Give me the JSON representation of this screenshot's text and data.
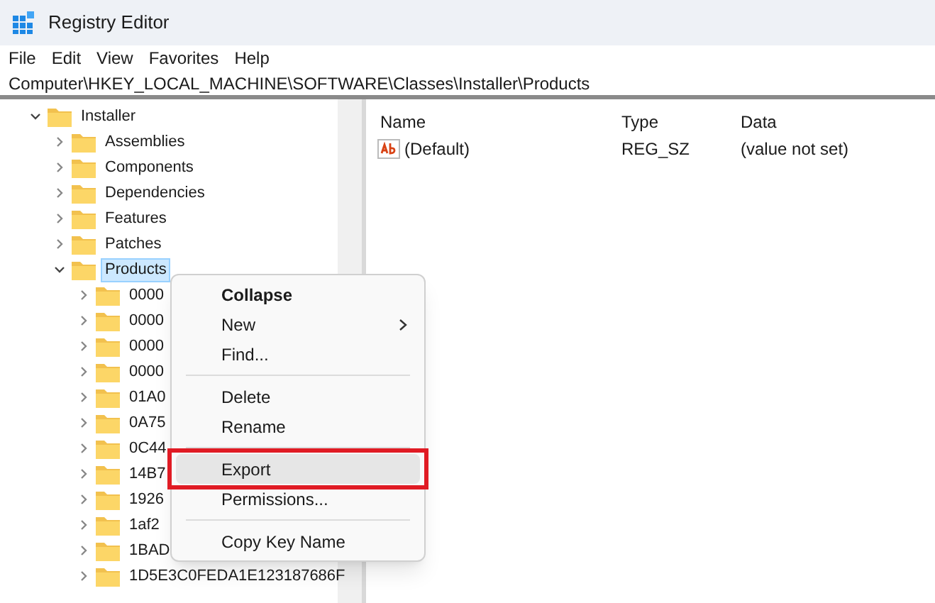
{
  "window": {
    "title": "Registry Editor"
  },
  "menu_bar": [
    "File",
    "Edit",
    "View",
    "Favorites",
    "Help"
  ],
  "address_bar": "Computer\\HKEY_LOCAL_MACHINE\\SOFTWARE\\Classes\\Installer\\Products",
  "tree": [
    {
      "label": "Installer",
      "expanded": true,
      "selected": false,
      "children": [
        {
          "label": "Assemblies",
          "expanded": false,
          "selected": false
        },
        {
          "label": "Components",
          "expanded": false,
          "selected": false
        },
        {
          "label": "Dependencies",
          "expanded": false,
          "selected": false
        },
        {
          "label": "Features",
          "expanded": false,
          "selected": false
        },
        {
          "label": "Patches",
          "expanded": false,
          "selected": false
        },
        {
          "label": "Products",
          "expanded": true,
          "selected": true,
          "children": [
            {
              "label": "0000",
              "expanded": false,
              "selected": false
            },
            {
              "label": "0000",
              "expanded": false,
              "selected": false
            },
            {
              "label": "0000",
              "expanded": false,
              "selected": false
            },
            {
              "label": "0000",
              "expanded": false,
              "selected": false
            },
            {
              "label": "01A0",
              "expanded": false,
              "selected": false
            },
            {
              "label": "0A75",
              "expanded": false,
              "selected": false
            },
            {
              "label": "0C44",
              "expanded": false,
              "selected": false
            },
            {
              "label": "14B7",
              "expanded": false,
              "selected": false
            },
            {
              "label": "1926",
              "expanded": false,
              "selected": false
            },
            {
              "label": "1af2",
              "expanded": false,
              "selected": false
            },
            {
              "label": "1BAD",
              "expanded": false,
              "selected": false
            },
            {
              "label": "1D5E3C0FEDA1E123187686F",
              "expanded": false,
              "selected": false
            }
          ]
        }
      ]
    }
  ],
  "values_table": {
    "columns": [
      "Name",
      "Type",
      "Data"
    ],
    "rows": [
      {
        "name": "(Default)",
        "type": "REG_SZ",
        "data": "(value not set)"
      }
    ]
  },
  "context_menu": [
    {
      "kind": "item",
      "label": "Collapse",
      "default": true,
      "submenu": false,
      "selected": false
    },
    {
      "kind": "item",
      "label": "New",
      "default": false,
      "submenu": true,
      "selected": false
    },
    {
      "kind": "item",
      "label": "Find...",
      "default": false,
      "submenu": false,
      "selected": false
    },
    {
      "kind": "separator"
    },
    {
      "kind": "item",
      "label": "Delete",
      "default": false,
      "submenu": false,
      "selected": false
    },
    {
      "kind": "item",
      "label": "Rename",
      "default": false,
      "submenu": false,
      "selected": false
    },
    {
      "kind": "separator"
    },
    {
      "kind": "item",
      "label": "Export",
      "default": false,
      "submenu": false,
      "selected": true
    },
    {
      "kind": "item",
      "label": "Permissions...",
      "default": false,
      "submenu": false,
      "selected": false
    },
    {
      "kind": "separator"
    },
    {
      "kind": "item",
      "label": "Copy Key Name",
      "default": false,
      "submenu": false,
      "selected": false
    }
  ]
}
